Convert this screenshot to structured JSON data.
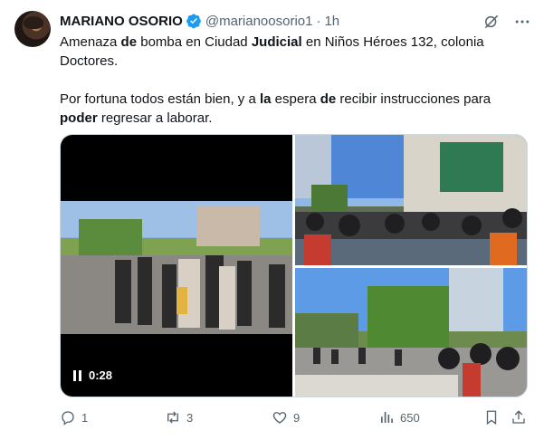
{
  "author": {
    "name": "MARIANO OSORIO",
    "handle": "@marianoosorio1",
    "separator": "·",
    "time": "1h"
  },
  "tweet": {
    "line1": [
      {
        "t": "Amenaza ",
        "b": false
      },
      {
        "t": "de",
        "b": true
      },
      {
        "t": " bomba en Ciudad ",
        "b": false
      },
      {
        "t": "Judicial",
        "b": true
      },
      {
        "t": " en Niños Héroes 132, colonia Doctores.",
        "b": false
      }
    ],
    "line2": [
      {
        "t": "Por fortuna todos están bien, y a ",
        "b": false
      },
      {
        "t": "la",
        "b": true
      },
      {
        "t": " espera ",
        "b": false
      },
      {
        "t": "de",
        "b": true
      },
      {
        "t": " recibir instrucciones para ",
        "b": false
      },
      {
        "t": "poder",
        "b": true
      },
      {
        "t": " regresar a laborar.",
        "b": false
      }
    ]
  },
  "video": {
    "duration": "0:28"
  },
  "actions": {
    "replies": "1",
    "retweets": "3",
    "likes": "9",
    "views": "650"
  },
  "colors": {
    "verified": "#1d9bf0",
    "secondary_text": "#536471",
    "icon": "#536471"
  }
}
